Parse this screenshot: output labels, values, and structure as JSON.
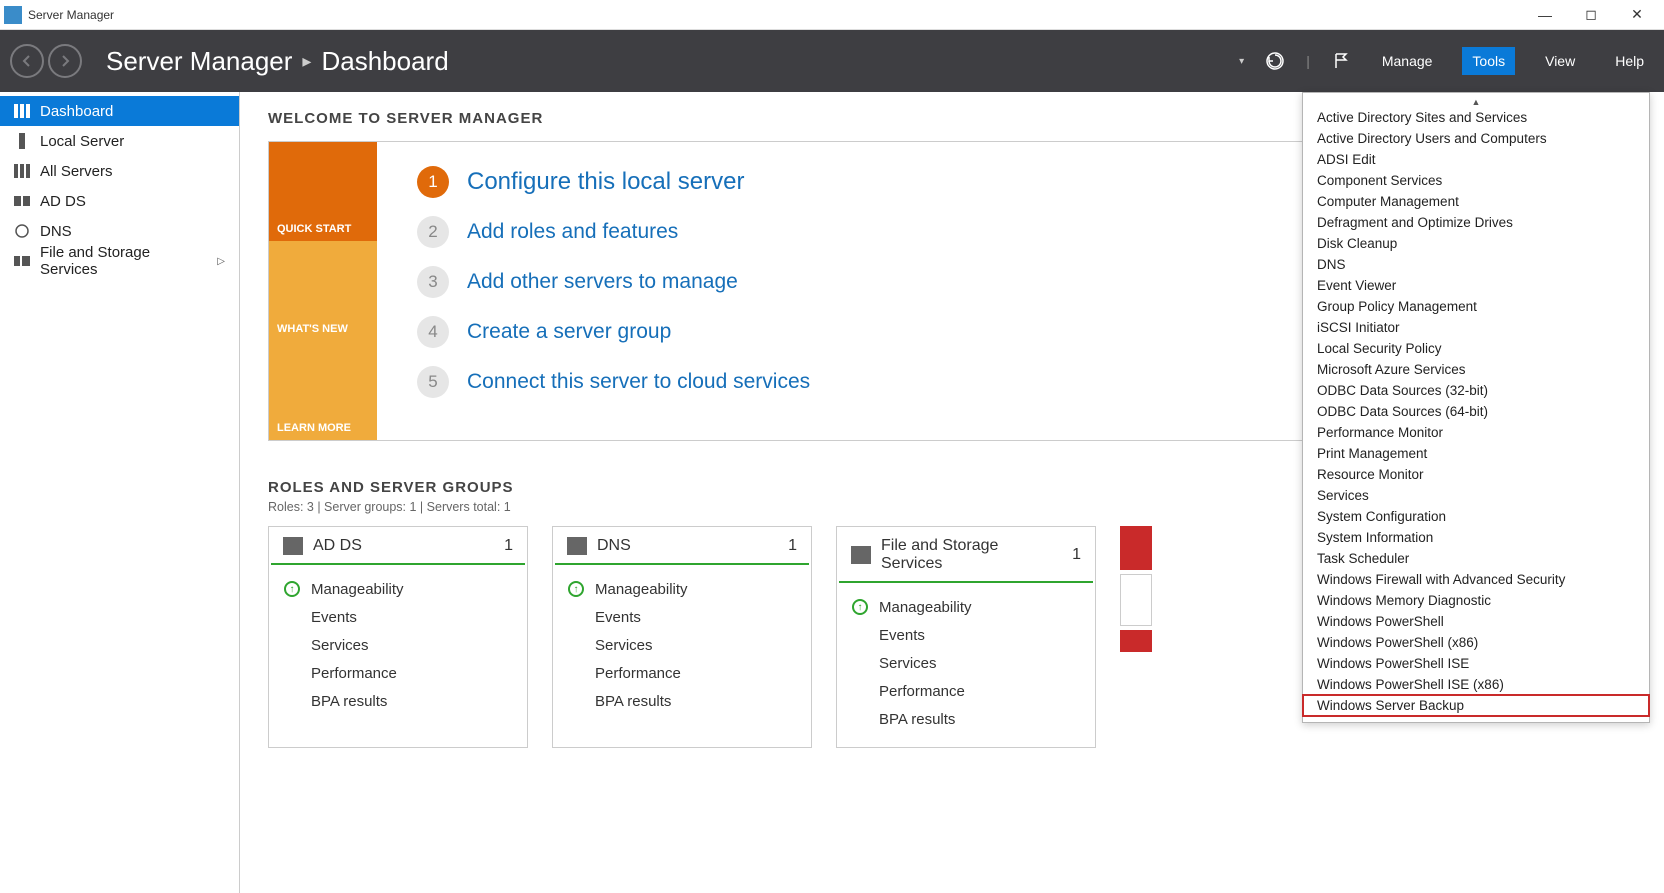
{
  "window": {
    "title": "Server Manager"
  },
  "header": {
    "breadcrumb": [
      "Server Manager",
      "Dashboard"
    ],
    "menus": {
      "manage": "Manage",
      "tools": "Tools",
      "view": "View",
      "help": "Help"
    }
  },
  "sidebar": {
    "items": [
      {
        "label": "Dashboard",
        "active": true
      },
      {
        "label": "Local Server"
      },
      {
        "label": "All Servers"
      },
      {
        "label": "AD DS"
      },
      {
        "label": "DNS"
      },
      {
        "label": "File and Storage Services",
        "expandable": true
      }
    ]
  },
  "welcome": {
    "title": "WELCOME TO SERVER MANAGER",
    "tabs": {
      "quick": "QUICK START",
      "whatsnew": "WHAT'S NEW",
      "learn": "LEARN MORE"
    },
    "steps": [
      {
        "n": "1",
        "label": "Configure this local server",
        "primary": true
      },
      {
        "n": "2",
        "label": "Add roles and features"
      },
      {
        "n": "3",
        "label": "Add other servers to manage"
      },
      {
        "n": "4",
        "label": "Create a server group"
      },
      {
        "n": "5",
        "label": "Connect this server to cloud services"
      }
    ]
  },
  "roles": {
    "title": "ROLES AND SERVER GROUPS",
    "sub": "Roles: 3   |   Server groups: 1   |   Servers total: 1",
    "row_labels": {
      "manage": "Manageability",
      "events": "Events",
      "services": "Services",
      "perf": "Performance",
      "bpa": "BPA results"
    },
    "tiles": [
      {
        "title": "AD DS",
        "count": "1"
      },
      {
        "title": "DNS",
        "count": "1"
      },
      {
        "title": "File and Storage Services",
        "count": "1"
      }
    ]
  },
  "tools_menu": [
    "Active Directory Sites and Services",
    "Active Directory Users and Computers",
    "ADSI Edit",
    "Component Services",
    "Computer Management",
    "Defragment and Optimize Drives",
    "Disk Cleanup",
    "DNS",
    "Event Viewer",
    "Group Policy Management",
    "iSCSI Initiator",
    "Local Security Policy",
    "Microsoft Azure Services",
    "ODBC Data Sources (32-bit)",
    "ODBC Data Sources (64-bit)",
    "Performance Monitor",
    "Print Management",
    "Resource Monitor",
    "Services",
    "System Configuration",
    "System Information",
    "Task Scheduler",
    "Windows Firewall with Advanced Security",
    "Windows Memory Diagnostic",
    "Windows PowerShell",
    "Windows PowerShell (x86)",
    "Windows PowerShell ISE",
    "Windows PowerShell ISE (x86)",
    "Windows Server Backup"
  ],
  "tools_highlight": "Windows Server Backup"
}
